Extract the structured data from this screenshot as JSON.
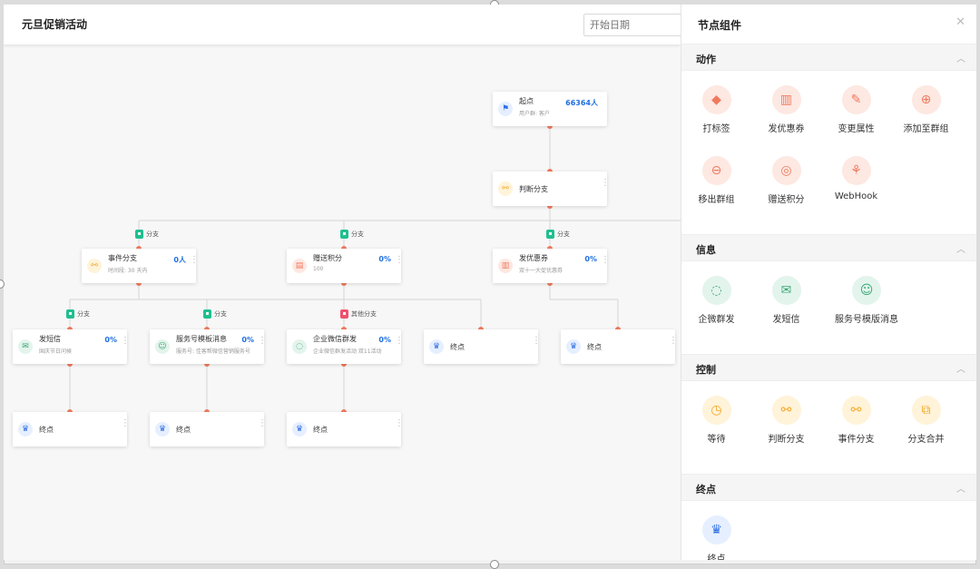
{
  "canvas": {
    "title": "元旦促销活动",
    "date_placeholder": "开始日期"
  },
  "nodes": {
    "start": {
      "name": "起点",
      "sub": "用户群: 客户",
      "stat": "66364人"
    },
    "judge": {
      "name": "判断分支"
    },
    "event": {
      "name": "事件分支",
      "sub": "时间段: 30 天内",
      "stat": "0人"
    },
    "points": {
      "name": "赠送积分",
      "sub": "100",
      "stat": "0%"
    },
    "coupon": {
      "name": "发优惠券",
      "sub": "双十一大促优惠券",
      "stat": "0%"
    },
    "sms": {
      "name": "发短信",
      "sub": "国庆节日问候",
      "stat": "0%"
    },
    "template": {
      "name": "服务号模板消息",
      "sub": "服务号: 佳客帮微信营销服务号",
      "stat": "0%"
    },
    "wechat": {
      "name": "企业微信群发",
      "sub": "企业微信群发活动 双11活动",
      "stat": "0%"
    },
    "end1": {
      "name": "终点"
    },
    "end2": {
      "name": "终点"
    },
    "end3": {
      "name": "终点"
    },
    "end4": {
      "name": "终点"
    },
    "end5": {
      "name": "终点"
    }
  },
  "tags": {
    "branch1": "分支",
    "branch2": "分支",
    "branch3": "分支",
    "branch4": "分支",
    "branch5": "分支",
    "other": "其他分支"
  },
  "panel": {
    "title": "节点组件",
    "sections": {
      "action": {
        "title": "动作",
        "items": [
          "打标签",
          "发优惠券",
          "变更属性",
          "添加至群组",
          "移出群组",
          "赠送积分",
          "WebHook"
        ]
      },
      "info": {
        "title": "信息",
        "items": [
          "企微群发",
          "发短信",
          "服务号模版消息"
        ]
      },
      "control": {
        "title": "控制",
        "items": [
          "等待",
          "判断分支",
          "事件分支",
          "分支合并"
        ]
      },
      "end": {
        "title": "终点",
        "items": [
          "终点"
        ]
      }
    }
  },
  "colors": {
    "accent_blue": "#1f6fe0",
    "link_dot": "#f07a5e",
    "branch_green": "#1fbf8f",
    "branch_red": "#f0506e",
    "action_bg": "#fde8e2",
    "action_fg": "#f07a5e",
    "info_bg": "#e3f4ec",
    "info_fg": "#3aa776",
    "control_bg": "#fff3d9",
    "control_fg": "#f5a623",
    "end_bg": "#e6efff",
    "end_fg": "#2f6fe4"
  }
}
